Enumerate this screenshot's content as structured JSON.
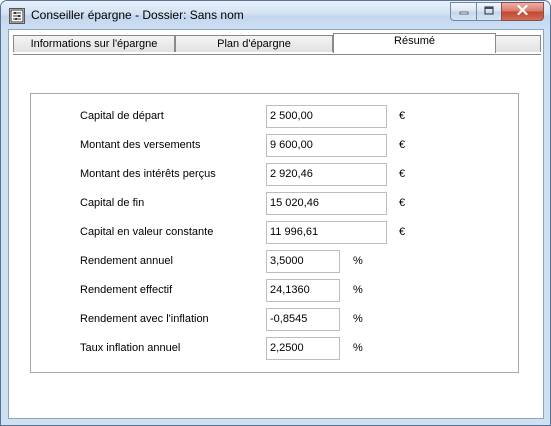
{
  "window": {
    "title": "Conseiller épargne - Dossier: Sans nom",
    "app_icon": "abacus-icon",
    "caption_buttons": [
      "minimize-icon",
      "maximize-icon",
      "close-icon"
    ]
  },
  "tabs": [
    {
      "label": "Informations sur l'épargne",
      "active": false
    },
    {
      "label": "Plan d'épargne",
      "active": false
    },
    {
      "label": "Résumé",
      "active": true
    }
  ],
  "summary": {
    "rows": [
      {
        "label": "Capital de départ",
        "value": "2 500,00",
        "unit": "€"
      },
      {
        "label": "Montant des versements",
        "value": "9 600,00",
        "unit": "€"
      },
      {
        "label": "Montant des intérêts perçus",
        "value": "2 920,46",
        "unit": "€"
      },
      {
        "label": "Capital de fin",
        "value": "15 020,46",
        "unit": "€"
      },
      {
        "label": "Capital en valeur constante",
        "value": "11 996,61",
        "unit": "€"
      },
      {
        "label": "Rendement annuel",
        "value": "3,5000",
        "unit": "%"
      },
      {
        "label": "Rendement effectif",
        "value": "24,1360",
        "unit": "%"
      },
      {
        "label": "Rendement avec l'inflation",
        "value": "-0,8545",
        "unit": "%"
      },
      {
        "label": "Taux inflation annuel",
        "value": "2,2500",
        "unit": "%"
      }
    ]
  }
}
